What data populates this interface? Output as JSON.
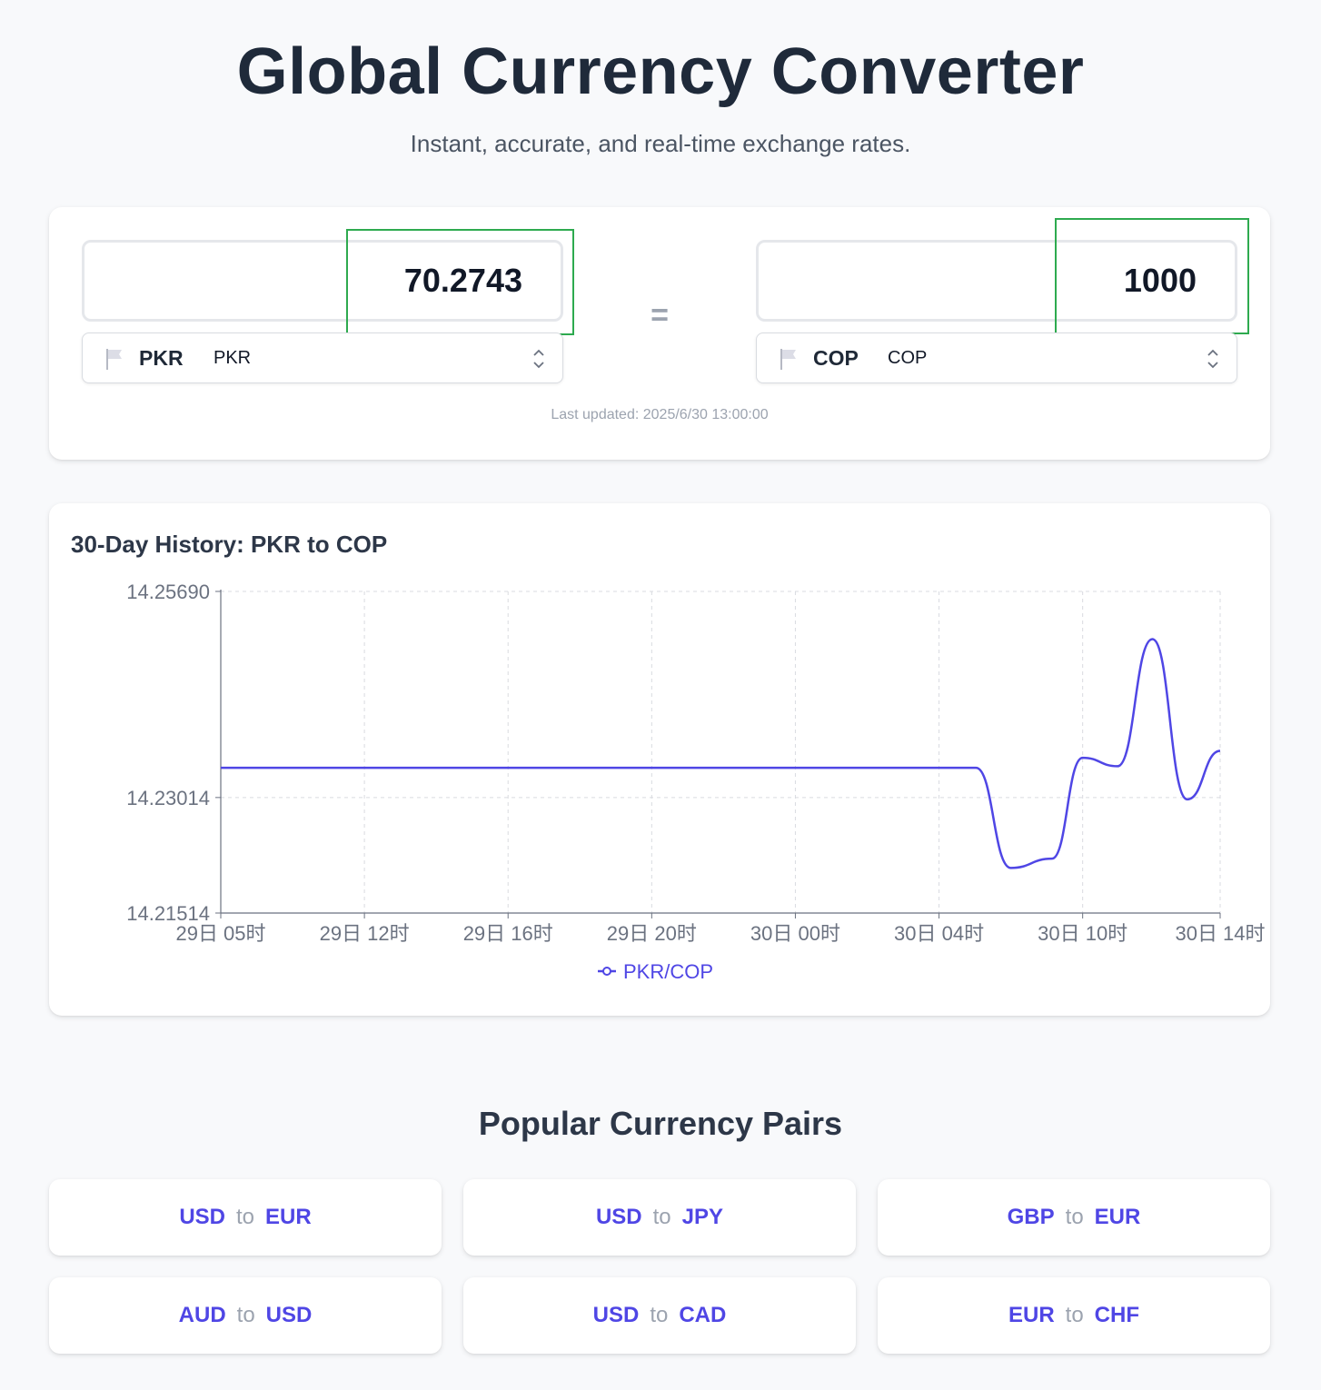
{
  "header": {
    "title": "Global Currency Converter",
    "subtitle": "Instant, accurate, and real-time exchange rates."
  },
  "converter": {
    "from_amount": "70.2743",
    "to_amount": "1000",
    "equals_sign": "=",
    "from_currency": {
      "code": "PKR",
      "name": "PKR",
      "icon": "flag-icon"
    },
    "to_currency": {
      "code": "COP",
      "name": "COP",
      "icon": "flag-icon"
    },
    "last_updated": "Last updated: 2025/6/30 13:00:00"
  },
  "history": {
    "title": "30-Day History: PKR to COP"
  },
  "chart_data": {
    "type": "line",
    "title": "30-Day History: PKR to COP",
    "xlabel": "",
    "ylabel": "",
    "ylim": [
      14.21514,
      14.2569
    ],
    "y_ticks": [
      "14.25690",
      "14.23014",
      "14.21514"
    ],
    "x_ticks": [
      {
        "label": "29日 05时",
        "t": 0
      },
      {
        "label": "29日 12时",
        "t": 7
      },
      {
        "label": "29日 16时",
        "t": 14
      },
      {
        "label": "29日 20时",
        "t": 21
      },
      {
        "label": "30日 00时",
        "t": 28
      },
      {
        "label": "30日 04时",
        "t": 35
      },
      {
        "label": "30日 10时",
        "t": 42
      },
      {
        "label": "30日 14时",
        "t": 48.7
      }
    ],
    "grid": true,
    "legend": "bottom-center",
    "series": [
      {
        "name": "PKR/COP",
        "color": "#4f46e5",
        "x": [
          0,
          7,
          14,
          21,
          28,
          35,
          36.8,
          38.5,
          40.5,
          42,
          43.7,
          45.4,
          47.1,
          48.7
        ],
        "values": [
          14.234,
          14.234,
          14.234,
          14.234,
          14.234,
          14.234,
          14.234,
          14.221,
          14.2222,
          14.2353,
          14.2342,
          14.2507,
          14.2299,
          14.2362
        ]
      }
    ]
  },
  "popular": {
    "heading": "Popular Currency Pairs",
    "connector": "to",
    "pairs": [
      {
        "from": "USD",
        "to": "EUR"
      },
      {
        "from": "USD",
        "to": "JPY"
      },
      {
        "from": "GBP",
        "to": "EUR"
      },
      {
        "from": "AUD",
        "to": "USD"
      },
      {
        "from": "USD",
        "to": "CAD"
      },
      {
        "from": "EUR",
        "to": "CHF"
      }
    ]
  },
  "colors": {
    "accent": "#4f46e5",
    "focus": "#2eaa4f",
    "background": "#f8f9fb"
  }
}
